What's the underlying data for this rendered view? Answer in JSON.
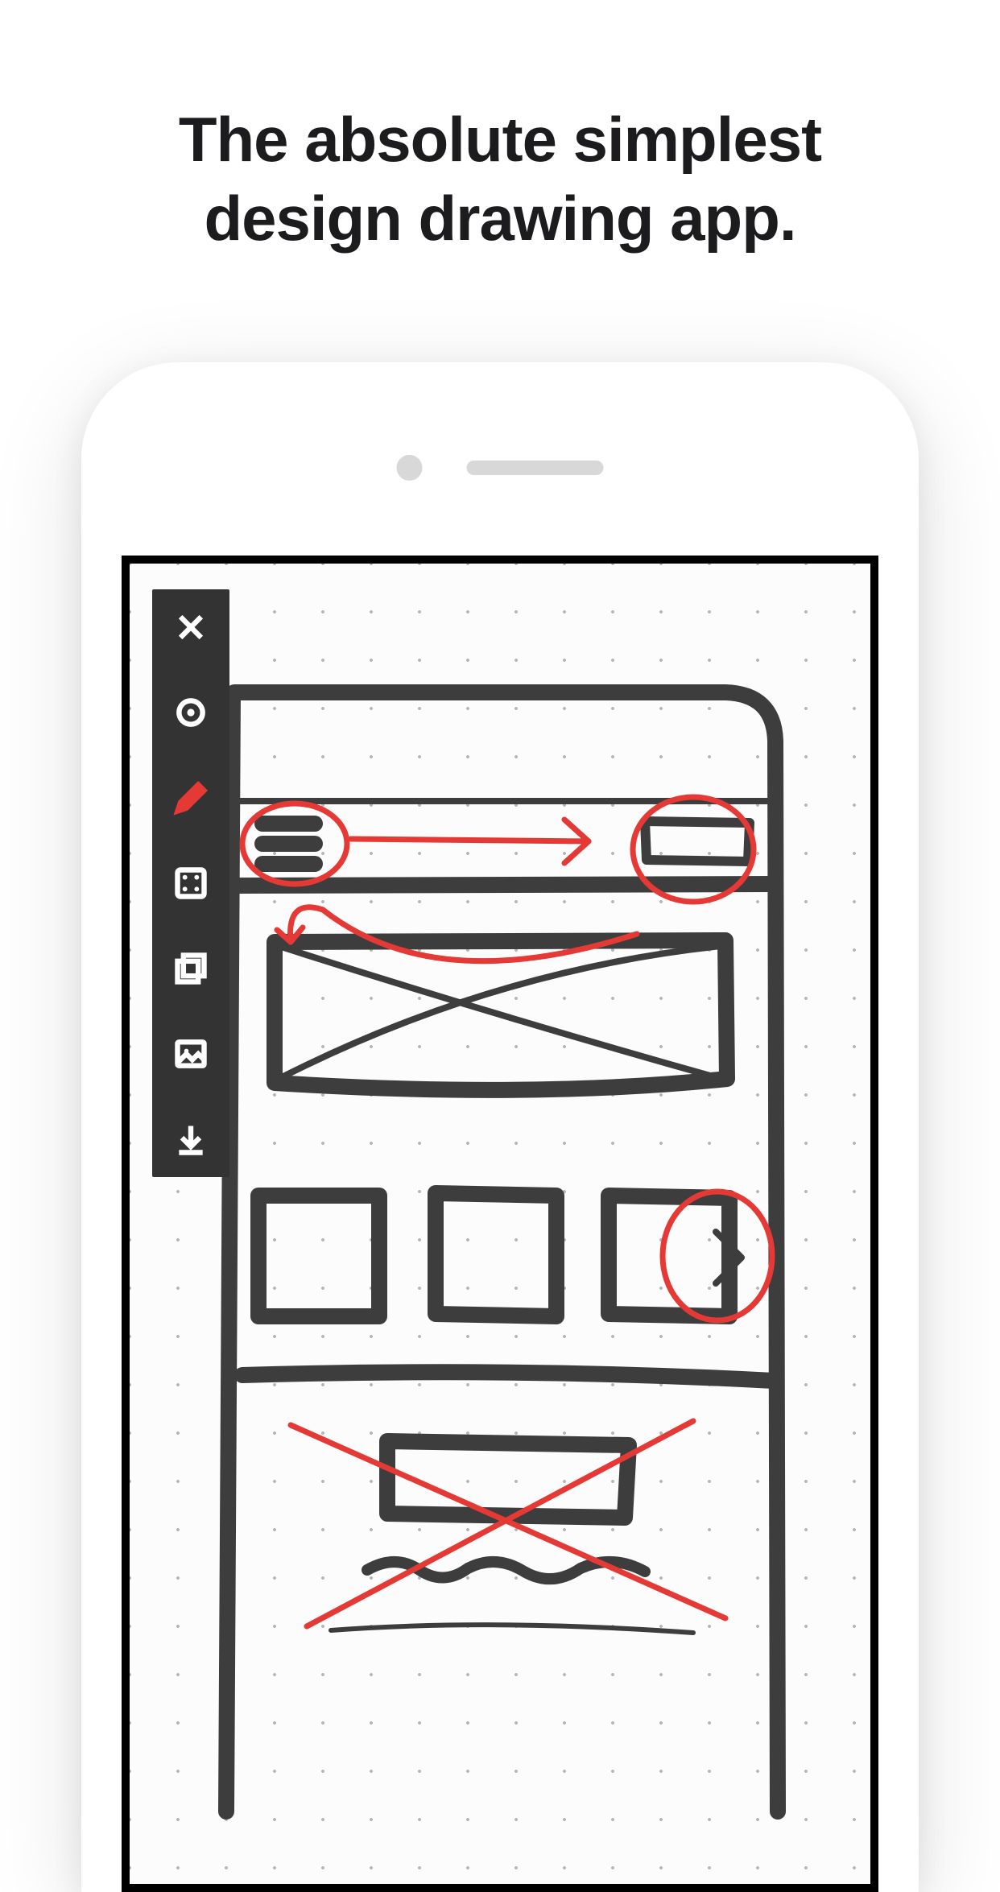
{
  "marketing": {
    "headline_line1": "The absolute simplest",
    "headline_line2": "design drawing app."
  },
  "toolbar": {
    "tools": [
      {
        "name": "close",
        "active": false
      },
      {
        "name": "record",
        "active": false
      },
      {
        "name": "pencil",
        "active": true
      },
      {
        "name": "dice",
        "active": false
      },
      {
        "name": "layers",
        "active": false
      },
      {
        "name": "image",
        "active": false
      },
      {
        "name": "download",
        "active": false
      }
    ]
  },
  "colors": {
    "annotation": "#e53935",
    "sketch": "#3d3d3d",
    "toolbar_bg": "#333333",
    "text": "#1c1c1e"
  }
}
